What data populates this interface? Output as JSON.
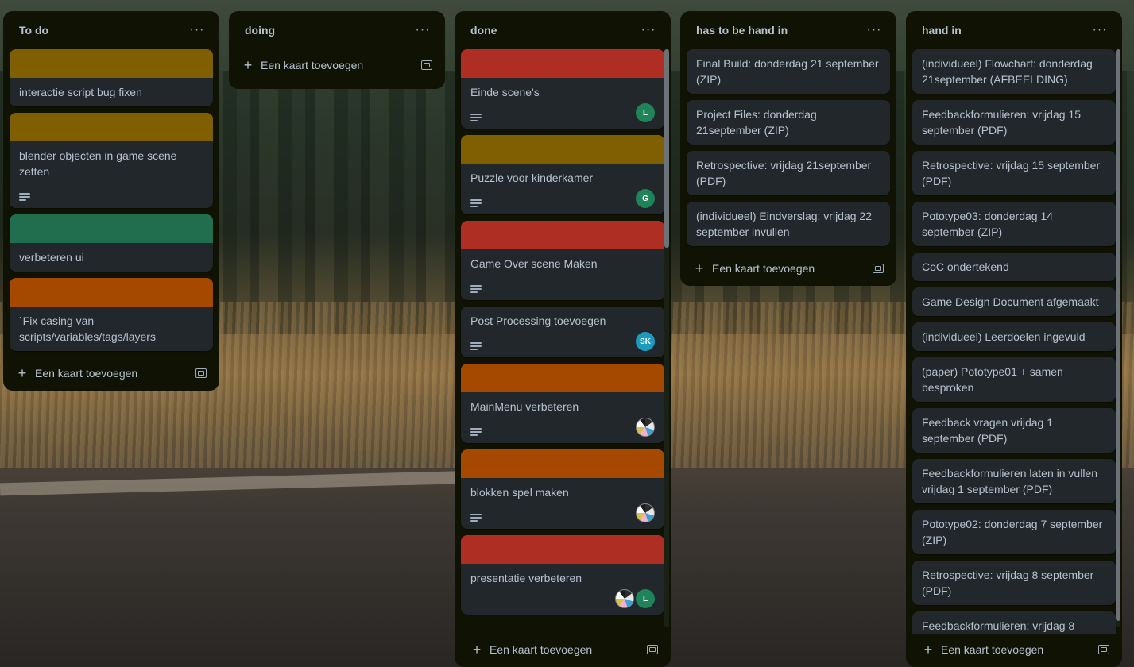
{
  "add_card_label": "Een kaart toevoegen",
  "menu_label": "···",
  "colors": {
    "yellow": "#7f5f01",
    "green": "#216e4e",
    "orange": "#a54800",
    "red": "#ae2e24",
    "avatar_green": "#1f845a",
    "avatar_teal": "#1d9bbd"
  },
  "lists": [
    {
      "title": "To do",
      "cards": [
        {
          "title": "interactie script bug fixen",
          "cover": "yellow"
        },
        {
          "title": "blender objecten in game scene zetten",
          "cover": "yellow",
          "has_description": true
        },
        {
          "title": "verbeteren ui",
          "cover": "green"
        },
        {
          "title": "`Fix casing van scripts/variables/tags/layers",
          "cover": "orange"
        }
      ]
    },
    {
      "title": "doing",
      "cards": []
    },
    {
      "title": "done",
      "cards": [
        {
          "title": "Einde scene's",
          "cover": "red",
          "has_description": true,
          "members": [
            "L"
          ]
        },
        {
          "title": "Puzzle voor kinderkamer",
          "cover": "yellow",
          "has_description": true,
          "members": [
            "G"
          ]
        },
        {
          "title": "Game Over scene Maken",
          "cover": "red",
          "has_description": true
        },
        {
          "title": "Post Processing toevoegen",
          "has_description": true,
          "members": [
            "SK"
          ]
        },
        {
          "title": "MainMenu verbeteren",
          "cover": "orange",
          "has_description": true,
          "members": [
            "img"
          ]
        },
        {
          "title": "blokken spel maken",
          "cover": "orange",
          "has_description": true,
          "members": [
            "img"
          ]
        },
        {
          "title": "presentatie verbeteren",
          "cover": "red",
          "members": [
            "img",
            "L"
          ]
        }
      ]
    },
    {
      "title": "has to be hand in",
      "cards": [
        {
          "title": "Final Build: donderdag 21 september (ZIP)"
        },
        {
          "title": "Project Files: donderdag 21september (ZIP)"
        },
        {
          "title": "Retrospective: vrijdag 21september (PDF)"
        },
        {
          "title": "(individueel) Eindverslag: vrijdag 22 september invullen"
        }
      ]
    },
    {
      "title": "hand in",
      "cards": [
        {
          "title": "(individueel) Flowchart: donderdag 21september (AFBEELDING)"
        },
        {
          "title": "Feedbackformulieren: vrijdag 15 september (PDF)"
        },
        {
          "title": "Retrospective: vrijdag 15 september (PDF)"
        },
        {
          "title": "Pototype03: donderdag 14 september (ZIP)"
        },
        {
          "title": "CoC ondertekend"
        },
        {
          "title": "Game Design Document afgemaakt"
        },
        {
          "title": "(individueel) Leerdoelen ingevuld"
        },
        {
          "title": "(paper) Pototype01 + samen besproken"
        },
        {
          "title": "Feedback vragen vrijdag 1 september (PDF)"
        },
        {
          "title": "Feedbackformulieren laten in vullen vrijdag 1 september (PDF)"
        },
        {
          "title": "Pototype02: donderdag 7 september (ZIP)"
        },
        {
          "title": "Retrospective: vrijdag 8 september (PDF)"
        },
        {
          "title": "Feedbackformulieren: vrijdag 8"
        }
      ]
    }
  ]
}
